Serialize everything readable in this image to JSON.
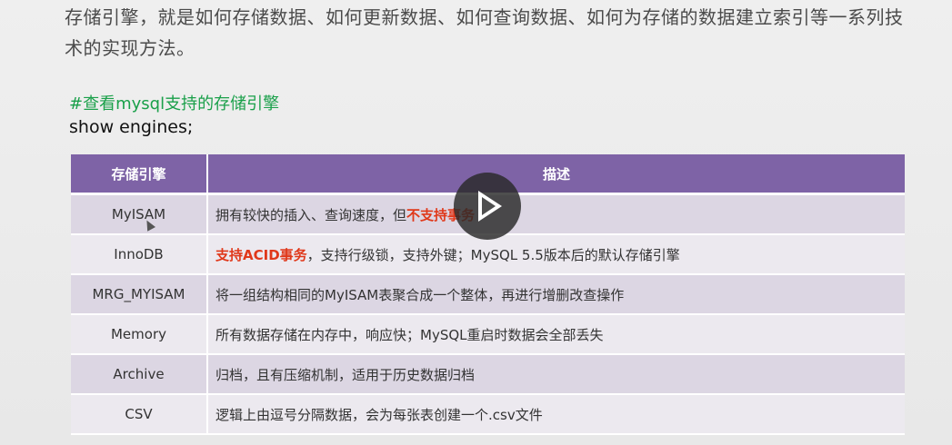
{
  "intro_text": "存储引擎，就是如何存储数据、如何更新数据、如何查询数据、如何为存储的数据建立索引等一系列技术的实现方法。",
  "code": {
    "comment": "#查看mysql支持的存储引擎",
    "statement": "show engines;"
  },
  "table": {
    "headers": [
      "存储引擎",
      "描述"
    ],
    "rows": [
      {
        "name": "MyISAM",
        "desc_pre": "拥有较快的插入、查询速度，但",
        "desc_highlight": "不支持事务",
        "desc_post": ""
      },
      {
        "name": "InnoDB",
        "desc_pre": "",
        "desc_highlight": "支持ACID事务",
        "desc_post": "，支持行级锁，支持外键；MySQL 5.5版本后的默认存储引擎"
      },
      {
        "name": "MRG_MYISAM",
        "desc_pre": "将一组结构相同的MyISAM表聚合成一个整体，再进行增删改查操作",
        "desc_highlight": "",
        "desc_post": ""
      },
      {
        "name": "Memory",
        "desc_pre": "所有数据存储在内存中，响应快；MySQL重启时数据会全部丢失",
        "desc_highlight": "",
        "desc_post": ""
      },
      {
        "name": "Archive",
        "desc_pre": "归档，且有压缩机制，适用于历史数据归档",
        "desc_highlight": "",
        "desc_post": ""
      },
      {
        "name": "CSV",
        "desc_pre": "逻辑上由逗号分隔数据，会为每张表创建一个.csv文件",
        "desc_highlight": "",
        "desc_post": ""
      }
    ]
  },
  "overlay": {
    "play_icon": "play-icon",
    "cursor_icon": "mouse-cursor-icon"
  },
  "colors": {
    "header_bg": "#7e63a6",
    "highlight": "#e0381a",
    "comment": "#1aa04a"
  }
}
